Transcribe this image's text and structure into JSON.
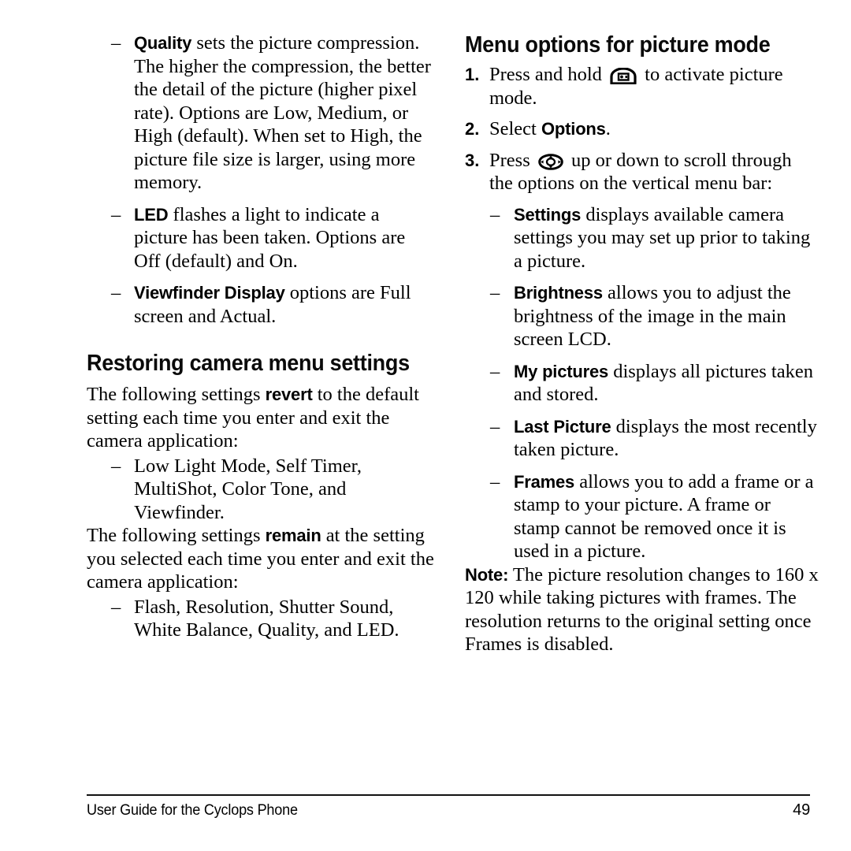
{
  "page": {
    "number": "49",
    "footer_title": "User Guide for the Cyclops Phone"
  },
  "left_column": {
    "continued_bullets": [
      {
        "dash": "–",
        "term": "Quality",
        "text": " sets the picture compression. The higher the compression, the better the detail of the picture (higher pixel rate). Options are Low, Medium, or High (default). When set to High, the picture file size is larger, using more memory."
      },
      {
        "dash": "–",
        "term": "LED",
        "text": " flashes a light to indicate a picture has been taken. Options are Off (default) and On."
      },
      {
        "dash": "–",
        "term": "Viewfinder Display",
        "text": " options are Full screen and Actual."
      }
    ],
    "heading": "Restoring camera menu settings",
    "revert_paragraph": {
      "before": "The following settings ",
      "term": "revert",
      "after": " to the default setting each time you enter and exit the camera application:"
    },
    "revert_list": [
      {
        "dash": "–",
        "text": "Low Light Mode, Self Timer, MultiShot, Color Tone, and Viewfinder."
      }
    ],
    "remain_paragraph": {
      "before": "The following settings ",
      "term": "remain",
      "after": " at the setting you selected each time you enter and exit the camera application:"
    },
    "remain_list": [
      {
        "dash": "–",
        "text": "Flash, Resolution, Shutter Sound, White Balance, Quality, and LED."
      }
    ]
  },
  "right_column": {
    "heading": "Menu options for picture mode",
    "steps": [
      {
        "num": "1.",
        "text_before": "Press and hold ",
        "icon": "camera-key-icon",
        "text_after": " to activate picture mode."
      },
      {
        "num": "2.",
        "text_before": "Select ",
        "term": "Options",
        "text_after": "."
      },
      {
        "num": "3.",
        "text_before": "Press ",
        "icon": "navigation-key-icon",
        "text_after": " up or down to scroll through the options on the vertical menu bar:"
      }
    ],
    "option_bullets": [
      {
        "dash": "–",
        "term": "Settings",
        "text": " displays available camera settings you may set up prior to taking a picture."
      },
      {
        "dash": "–",
        "term": "Brightness",
        "text": " allows you to adjust the brightness of the image in the main screen LCD."
      },
      {
        "dash": "–",
        "term": "My pictures",
        "text": " displays all pictures taken and stored."
      },
      {
        "dash": "–",
        "term": "Last Picture",
        "text": " displays the most recently taken picture."
      },
      {
        "dash": "–",
        "term": "Frames",
        "text": " allows you to add a frame or a stamp to your picture. A frame or stamp cannot be removed once it is used in a picture."
      }
    ],
    "note": {
      "label": "Note:",
      "text": " The picture resolution changes to 160 x 120 while taking pictures with frames. The resolution returns to the original setting once Frames is disabled."
    }
  },
  "colors": {
    "text": "#000000",
    "background": "#ffffff",
    "rule": "#111111"
  }
}
